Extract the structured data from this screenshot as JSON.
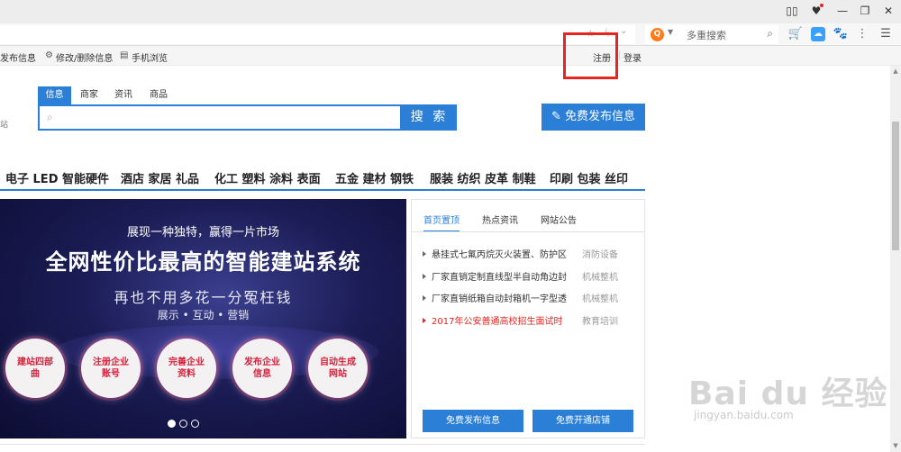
{
  "browser": {
    "controls": [
      "▯▯",
      "♥",
      "—",
      "❐",
      "✕"
    ],
    "search_engine_text": "多重搜索"
  },
  "topbar": {
    "items": [
      "发布信息",
      "修改/删除信息",
      "手机浏览"
    ],
    "register": "注册",
    "login": "登录"
  },
  "search": {
    "tabs": [
      "信息",
      "商家",
      "资讯",
      "商品"
    ],
    "button": "搜 索",
    "publish": "免费发布信息",
    "left_stub": "站"
  },
  "categories": [
    "电子 LED 智能硬件",
    "酒店 家居 礼品",
    "化工 塑料 涂料 表面",
    "五金 建材 钢铁",
    "服装 纺织 皮革 制鞋",
    "印刷 包装 丝印"
  ],
  "banner": {
    "line1": "展现一种独特，赢得一片市场",
    "line2": "全网性价比最高的智能建站系统",
    "line3": "再也不用多花一分冤枉钱",
    "line4": "展示 • 互动 • 营销",
    "circles": [
      "建站四部曲",
      "注册企业账号",
      "完善企业资料",
      "发布企业信息",
      "自动生成网站"
    ]
  },
  "news": {
    "tabs": [
      "首页置顶",
      "热点资讯",
      "网站公告"
    ],
    "items": [
      {
        "title": "悬挂式七氟丙烷灭火装置、防护区",
        "category": "消防设备",
        "highlight": false
      },
      {
        "title": "厂家直销定制直线型半自动角边封",
        "category": "机械整机",
        "highlight": false
      },
      {
        "title": "厂家直销纸箱自动封箱机一字型透",
        "category": "机械整机",
        "highlight": false
      },
      {
        "title": "2017年公安普通高校招生面试时",
        "category": "教育培训",
        "highlight": true
      }
    ],
    "btn_publish": "免费发布信息",
    "btn_shop": "免费开通店铺"
  },
  "watermark": {
    "big": "Bai du 经验",
    "small": "jingyan.baidu.com"
  },
  "colors": {
    "accent": "#2b7fd7",
    "highlight_box": "#e8241f"
  }
}
